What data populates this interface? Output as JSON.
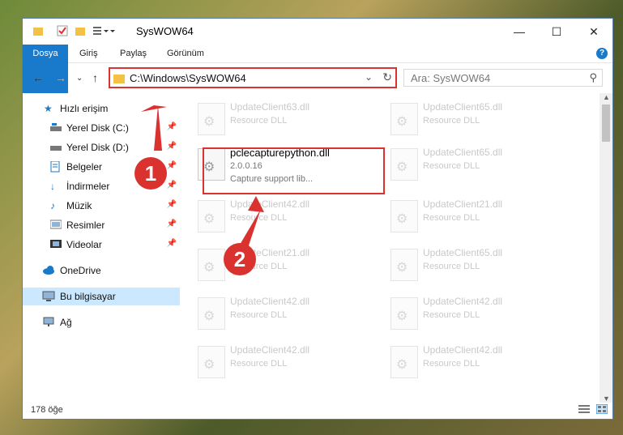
{
  "window": {
    "title": "SysWOW64",
    "controls": {
      "minimize": "—",
      "maximize": "☐",
      "close": "✕"
    }
  },
  "ribbon": {
    "tabs": [
      "Dosya",
      "Giriş",
      "Paylaş",
      "Görünüm"
    ],
    "help": "?"
  },
  "nav": {
    "address": "C:\\Windows\\SysWOW64",
    "search_placeholder": "Ara: SysWOW64"
  },
  "sidebar": {
    "quick_access": "Hızlı erişim",
    "items": [
      {
        "label": "Yerel Disk (C:)",
        "pinned": true
      },
      {
        "label": "Yerel Disk (D:)",
        "pinned": true
      },
      {
        "label": "Belgeler",
        "pinned": true
      },
      {
        "label": "İndirmeler",
        "pinned": true
      },
      {
        "label": "Müzik",
        "pinned": true
      },
      {
        "label": "Resimler",
        "pinned": true
      },
      {
        "label": "Videolar",
        "pinned": true
      }
    ],
    "onedrive": "OneDrive",
    "this_pc": "Bu bilgisayar",
    "network": "Ağ"
  },
  "files": [
    {
      "name": "UpdateClient63.dll",
      "type": "Resource DLL"
    },
    {
      "name": "UpdateClient65.dll",
      "type": "Resource DLL"
    },
    {
      "name": "pclecapturepython.dll",
      "version": "2.0.0.16",
      "desc": "Capture support lib..."
    },
    {
      "name": "UpdateClient65.dll",
      "type": "Resource DLL"
    },
    {
      "name": "UpdateClient42.dll",
      "type": "Resource DLL"
    },
    {
      "name": "UpdateClient21.dll",
      "type": "Resource DLL"
    },
    {
      "name": "UpdateClient21.dll",
      "type": "Resource DLL"
    },
    {
      "name": "UpdateClient65.dll",
      "type": "Resource DLL"
    },
    {
      "name": "UpdateClient42.dll",
      "type": "Resource DLL"
    },
    {
      "name": "UpdateClient42.dll",
      "type": "Resource DLL"
    },
    {
      "name": "UpdateClient42.dll",
      "type": "Resource DLL"
    },
    {
      "name": "UpdateClient42.dll",
      "type": "Resource DLL"
    }
  ],
  "status": {
    "count": "178 öğe"
  },
  "markers": {
    "one": "1",
    "two": "2"
  },
  "colors": {
    "accent": "#1979ca",
    "highlight": "#d9322f",
    "selected": "#cce8ff"
  }
}
